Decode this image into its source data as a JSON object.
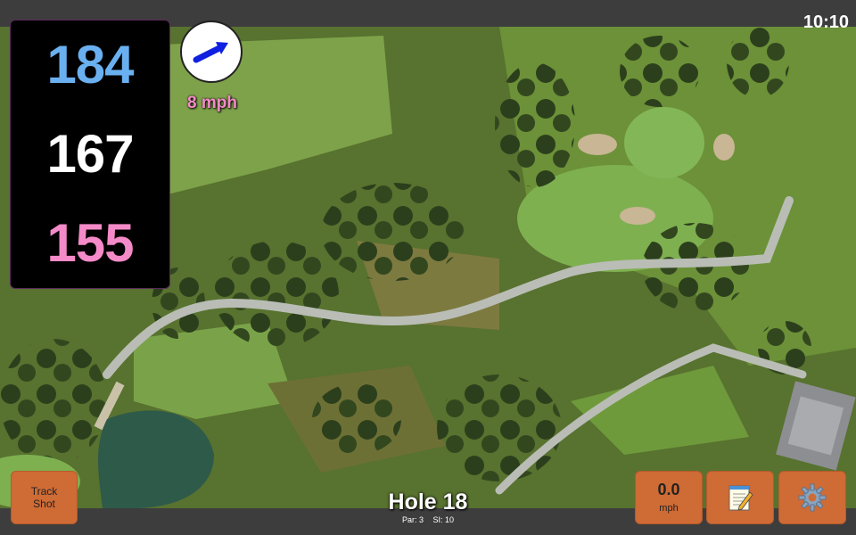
{
  "status": {
    "time": "10:10"
  },
  "distances": {
    "back": "184",
    "middle": "167",
    "front": "155"
  },
  "wind": {
    "speed": "8 mph",
    "direction_icon": "wind-arrow-icon"
  },
  "hole": {
    "title": "Hole 18",
    "par": "Par: 3",
    "stroke_index": "SI: 10"
  },
  "buttons": {
    "track_shot_line1": "Track",
    "track_shot_line2": "Shot",
    "speed_value": "0.0",
    "speed_unit": "mph",
    "notes_icon": "notepad-icon",
    "settings_icon": "gear-icon"
  },
  "colors": {
    "back": "#6ab0f0",
    "middle": "#ffffff",
    "front": "#f58ac8",
    "button": "#cf6b35",
    "bar": "#3d3d3d"
  }
}
